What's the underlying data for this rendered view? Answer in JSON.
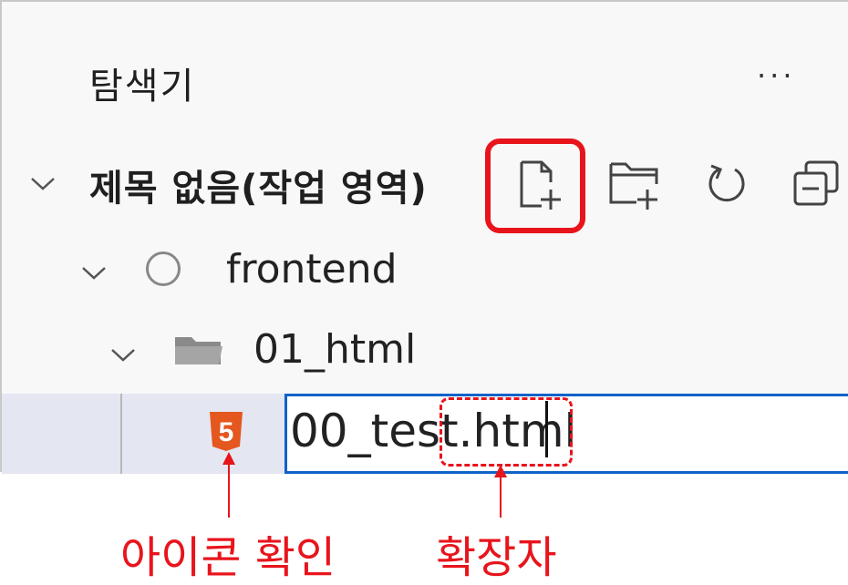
{
  "explorer": {
    "title": "탐색기",
    "more_label": "···"
  },
  "workspace": {
    "label": "제목 없음(작업 영역)",
    "toolbar": [
      {
        "name": "new-file",
        "icon": "new-file-icon"
      },
      {
        "name": "new-folder",
        "icon": "new-folder-icon"
      },
      {
        "name": "refresh",
        "icon": "refresh-icon"
      },
      {
        "name": "collapse-all",
        "icon": "collapse-all-icon"
      }
    ]
  },
  "tree": {
    "root_folder": "frontend",
    "sub_folder": "01_html",
    "new_file_input_value": "00_test.html"
  },
  "annotations": {
    "icon_check": "아이콘 확인",
    "extension": "확장자"
  },
  "colors": {
    "highlight": "#e8141c",
    "input_border": "#0f62c8",
    "html5": "#e4571e"
  }
}
